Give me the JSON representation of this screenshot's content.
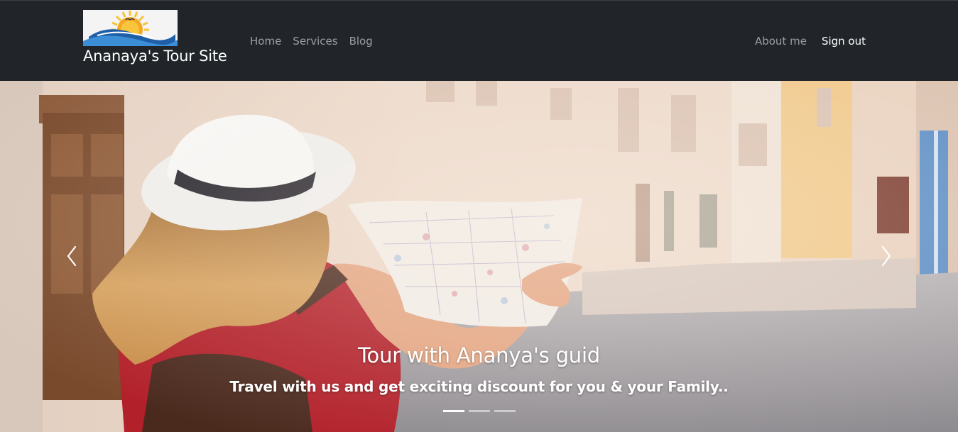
{
  "brand": {
    "name": "Ananaya's Tour Site",
    "logo_icon": "sun-over-waves-logo",
    "colors": {
      "sun": "#f5a623",
      "rays": "#f7c233",
      "wave_dark": "#1f5fa8",
      "wave_light": "#3c8fd6"
    }
  },
  "navbar": {
    "background": "#212529",
    "left_links": [
      {
        "label": "Home"
      },
      {
        "label": "Services"
      },
      {
        "label": "Blog"
      }
    ],
    "right_links": [
      {
        "label": "About me",
        "active": false
      },
      {
        "label": "Sign out",
        "active": true
      }
    ]
  },
  "carousel": {
    "caption_title": "Tour with Ananya's guid",
    "caption_text": "Travel with us and get exciting discount for you & your Family..",
    "prev_icon": "chevron-left-icon",
    "next_icon": "chevron-right-icon",
    "indicator_count": 3,
    "active_indicator": 0
  }
}
